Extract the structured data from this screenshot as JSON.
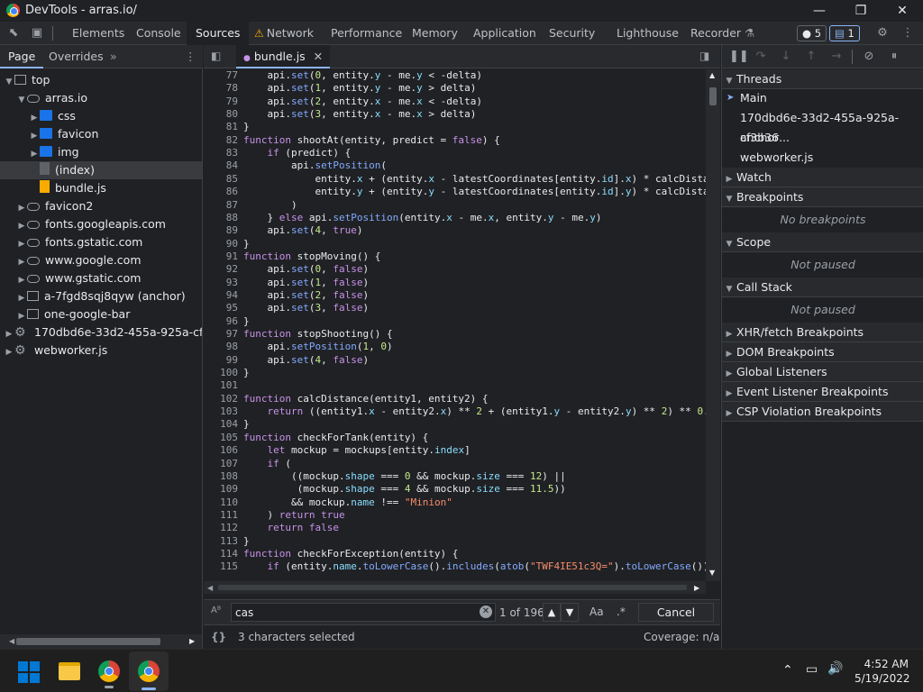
{
  "window": {
    "title": "DevTools - arras.io/"
  },
  "toolbar": {
    "tabs": [
      "Elements",
      "Console",
      "Sources",
      "Network",
      "Performance",
      "Memory",
      "Application",
      "Security",
      "Lighthouse",
      "Recorder"
    ],
    "active_tab": "Sources",
    "issues_count": "5",
    "messages_count": "1"
  },
  "navigator": {
    "tabs": [
      "Page",
      "Overrides"
    ],
    "tree": [
      {
        "label": "top",
        "icon": "frame-icon",
        "depth": 0,
        "arrow": "open"
      },
      {
        "label": "arras.io",
        "icon": "cloud-icon",
        "depth": 1,
        "arrow": "open"
      },
      {
        "label": "css",
        "icon": "folder-icon",
        "depth": 2,
        "arrow": "closed"
      },
      {
        "label": "favicon",
        "icon": "folder-icon",
        "depth": 2,
        "arrow": "closed"
      },
      {
        "label": "img",
        "icon": "folder-icon",
        "depth": 2,
        "arrow": "closed"
      },
      {
        "label": "(index)",
        "icon": "file-icon",
        "depth": 2,
        "arrow": "none",
        "selected": true
      },
      {
        "label": "bundle.js",
        "icon": "js-file-icon",
        "depth": 2,
        "arrow": "none"
      },
      {
        "label": "favicon2",
        "icon": "cloud-icon",
        "depth": 1,
        "arrow": "closed"
      },
      {
        "label": "fonts.googleapis.com",
        "icon": "cloud-icon",
        "depth": 1,
        "arrow": "closed"
      },
      {
        "label": "fonts.gstatic.com",
        "icon": "cloud-icon",
        "depth": 1,
        "arrow": "closed"
      },
      {
        "label": "www.google.com",
        "icon": "cloud-icon",
        "depth": 1,
        "arrow": "closed"
      },
      {
        "label": "www.gstatic.com",
        "icon": "cloud-icon",
        "depth": 1,
        "arrow": "closed"
      },
      {
        "label": "a-7fgd8sqj8qyw (anchor)",
        "icon": "frame-icon",
        "depth": 1,
        "arrow": "closed"
      },
      {
        "label": "one-google-bar",
        "icon": "frame-icon",
        "depth": 1,
        "arrow": "closed"
      },
      {
        "label": "170dbd6e-33d2-455a-925a-cf3b36",
        "icon": "gear-icon",
        "depth": 0,
        "arrow": "closed"
      },
      {
        "label": "webworker.js",
        "icon": "gear-icon",
        "depth": 0,
        "arrow": "closed"
      }
    ]
  },
  "editor": {
    "file_tab": "bundle.js",
    "lines": [
      {
        "n": "77",
        "code": "    api.set(0, entity.y - me.y < -delta)"
      },
      {
        "n": "78",
        "code": "    api.set(1, entity.y - me.y > delta)"
      },
      {
        "n": "79",
        "code": "    api.set(2, entity.x - me.x < -delta)"
      },
      {
        "n": "80",
        "code": "    api.set(3, entity.x - me.x > delta)"
      },
      {
        "n": "81",
        "code": "}"
      },
      {
        "n": "82",
        "code": "function shootAt(entity, predict = false) {"
      },
      {
        "n": "83",
        "code": "    if (predict) {"
      },
      {
        "n": "84",
        "code": "        api.setPosition("
      },
      {
        "n": "85",
        "code": "            entity.x + (entity.x - latestCoordinates[entity.id].x) * calcDista"
      },
      {
        "n": "86",
        "code": "            entity.y + (entity.y - latestCoordinates[entity.id].y) * calcDista"
      },
      {
        "n": "87",
        "code": "        )"
      },
      {
        "n": "88",
        "code": "    } else api.setPosition(entity.x - me.x, entity.y - me.y)"
      },
      {
        "n": "89",
        "code": "    api.set(4, true)"
      },
      {
        "n": "90",
        "code": "}"
      },
      {
        "n": "91",
        "code": "function stopMoving() {"
      },
      {
        "n": "92",
        "code": "    api.set(0, false)"
      },
      {
        "n": "93",
        "code": "    api.set(1, false)"
      },
      {
        "n": "94",
        "code": "    api.set(2, false)"
      },
      {
        "n": "95",
        "code": "    api.set(3, false)"
      },
      {
        "n": "96",
        "code": "}"
      },
      {
        "n": "97",
        "code": "function stopShooting() {"
      },
      {
        "n": "98",
        "code": "    api.setPosition(1, 0)"
      },
      {
        "n": "99",
        "code": "    api.set(4, false)"
      },
      {
        "n": "100",
        "code": "}"
      },
      {
        "n": "101",
        "code": ""
      },
      {
        "n": "102",
        "code": "function calcDistance(entity1, entity2) {"
      },
      {
        "n": "103",
        "code": "    return ((entity1.x - entity2.x) ** 2 + (entity1.y - entity2.y) ** 2) ** 0."
      },
      {
        "n": "104",
        "code": "}"
      },
      {
        "n": "105",
        "code": "function checkForTank(entity) {"
      },
      {
        "n": "106",
        "code": "    let mockup = mockups[entity.index]"
      },
      {
        "n": "107",
        "code": "    if ("
      },
      {
        "n": "108",
        "code": "        ((mockup.shape === 0 && mockup.size === 12) ||"
      },
      {
        "n": "109",
        "code": "         (mockup.shape === 4 && mockup.size === 11.5))"
      },
      {
        "n": "110",
        "code": "        && mockup.name !== \"Minion\""
      },
      {
        "n": "111",
        "code": "    ) return true"
      },
      {
        "n": "112",
        "code": "    return false"
      },
      {
        "n": "113",
        "code": "}"
      },
      {
        "n": "114",
        "code": "function checkForException(entity) {"
      },
      {
        "n": "115",
        "code": "    if (entity.name.toLowerCase().includes(atob(\"TWF4IE51c3Q=\").toLowerCase())"
      }
    ]
  },
  "search": {
    "query": "cas",
    "match_info": "1 of 196",
    "case_label": "Aa",
    "regex_label": ".*",
    "cancel_label": "Cancel"
  },
  "status": {
    "selection": "3 characters selected",
    "coverage": "Coverage: n/a",
    "braces": "{}"
  },
  "debugger": {
    "threads_label": "Threads",
    "threads": [
      "Main",
      "170dbd6e-33d2-455a-925a-cf3b36...",
      "anchor",
      "webworker.js"
    ],
    "watch_label": "Watch",
    "breakpoints_label": "Breakpoints",
    "no_breakpoints": "No breakpoints",
    "scope_label": "Scope",
    "scope_state": "Not paused",
    "callstack_label": "Call Stack",
    "callstack_state": "Not paused",
    "sections": [
      "XHR/fetch Breakpoints",
      "DOM Breakpoints",
      "Global Listeners",
      "Event Listener Breakpoints",
      "CSP Violation Breakpoints"
    ]
  },
  "taskbar": {
    "time": "4:52 AM",
    "date": "5/19/2022"
  },
  "colors": {
    "accent": "#8ab4f8",
    "search_highlight": "#1f7a1f",
    "folder": "#1a73e8"
  }
}
